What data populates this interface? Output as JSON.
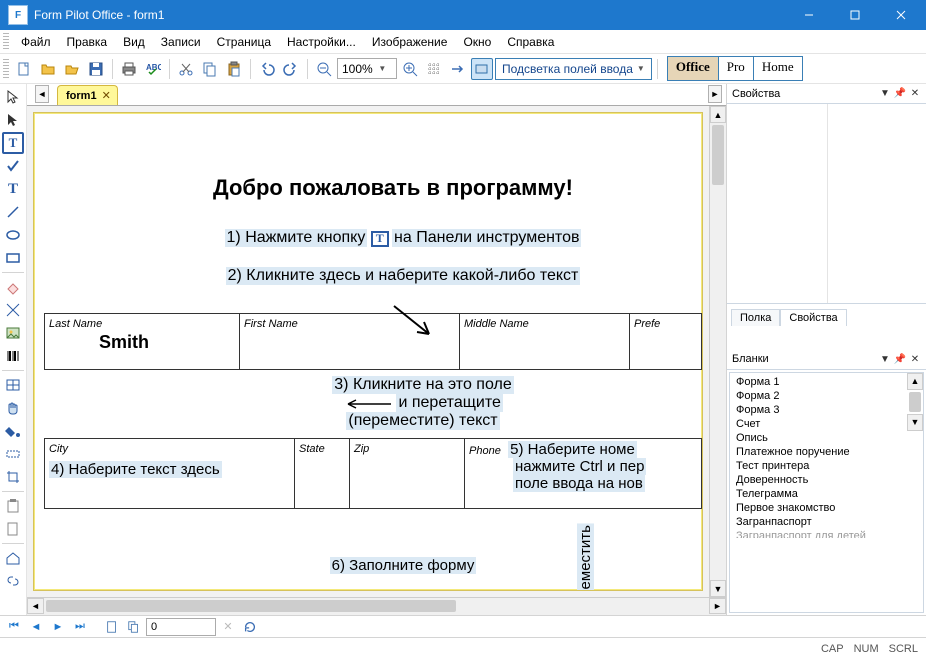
{
  "window": {
    "title": "Form Pilot Office - form1"
  },
  "menu": {
    "file": "Файл",
    "edit": "Правка",
    "view": "Вид",
    "records": "Записи",
    "page": "Страница",
    "settings": "Настройки...",
    "image": "Изображение",
    "window": "Окно",
    "help": "Справка"
  },
  "toolbar": {
    "zoom": "100%",
    "highlight_inputs": "Подсветка полей ввода",
    "mode_office": "Office",
    "mode_pro": "Pro",
    "mode_home": "Home"
  },
  "tabs": {
    "form1": "form1"
  },
  "doc": {
    "title": "Добро пожаловать в программу!",
    "step1_a": "1) Нажмите кнопку ",
    "step1_b": " на Панели инструментов",
    "step2": "2) Кликните здесь и наберите какой-либо текст",
    "step3_l1": "3) Кликните на это поле",
    "step3_l2": "и перетащите",
    "step3_l3": "(переместите) текст",
    "step4": "4) Наберите текст здесь",
    "step5_l1": "5) Наберите номе",
    "step5_l2": "нажмите Ctrl и пер",
    "step5_l3": "поле ввода на нов",
    "step6": "6) Заполните форму",
    "move_vert": "еместить",
    "fields": {
      "lastname_label": "Last Name",
      "lastname_value": "Smith",
      "firstname_label": "First Name",
      "middlename_label": "Middle Name",
      "prefix_label": "Prefe",
      "city_label": "City",
      "state_label": "State",
      "zip_label": "Zip",
      "phone_label": "Phone"
    }
  },
  "panels": {
    "properties_title": "Свойства",
    "tab_shelf": "Полка",
    "tab_props": "Свойства",
    "blanks_title": "Бланки",
    "blanks": [
      "Форма 1",
      "Форма 2",
      "Форма 3",
      "Счет",
      "Опись",
      "Платежное поручение",
      "Тест принтера",
      "Доверенность",
      "Телеграмма",
      "Первое знакомство",
      "Загранпаспорт",
      "Загранпаспорт для детей"
    ]
  },
  "nav": {
    "page": "0"
  },
  "status": {
    "cap": "CAP",
    "num": "NUM",
    "scrl": "SCRL"
  }
}
